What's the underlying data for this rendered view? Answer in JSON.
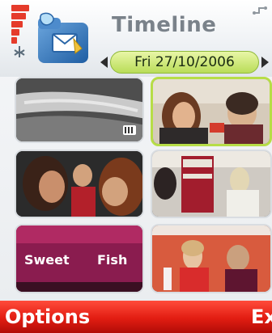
{
  "header": {
    "title": "Timeline",
    "date": "Fri 27/10/2006"
  },
  "thumbnails": [
    {
      "type": "video"
    },
    {
      "type": "photo",
      "selected": true
    },
    {
      "type": "photo"
    },
    {
      "type": "photo"
    },
    {
      "type": "photo",
      "sign_text_1": "Sweet",
      "sign_text_2": "Fish"
    },
    {
      "type": "photo"
    }
  ],
  "softkeys": {
    "left": "Options",
    "right": "Ex"
  },
  "colors": {
    "softbar": "#e21d12",
    "date_pill": "#b9dd58",
    "title": "#7a828a"
  }
}
